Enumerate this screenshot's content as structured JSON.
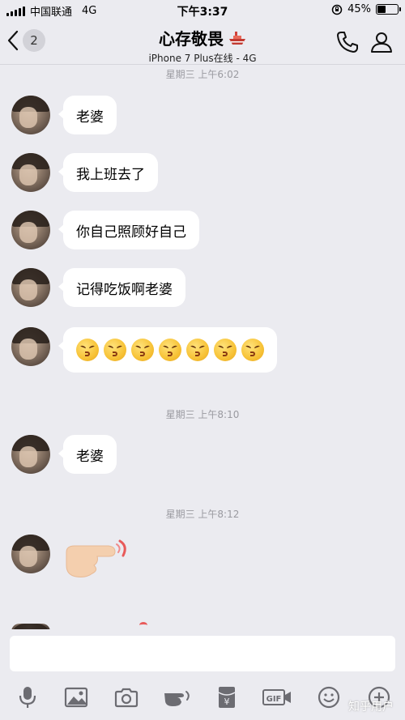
{
  "status_bar": {
    "carrier": "中国联通",
    "network": "4G",
    "time": "下午3:37",
    "battery_percent_label": "45%",
    "battery_level": 0.45
  },
  "header": {
    "back_count": "2",
    "title": "心存敬畏",
    "title_emoji": "ship-icon",
    "subtitle": "iPhone 7 Plus在线 - 4G"
  },
  "timestamps": [
    "星期三 上午6:02",
    "星期三 上午8:10",
    "星期三 上午8:12"
  ],
  "messages": [
    {
      "text": "老婆"
    },
    {
      "text": "我上班去了"
    },
    {
      "text": "你自己照顾好自己"
    },
    {
      "text": "记得吃饭啊老婆"
    },
    {
      "emoji": "kissing-face-icon",
      "count": 7
    },
    {
      "text": "老婆"
    },
    {
      "emoji": "pointing-hand-icon"
    }
  ],
  "input": {
    "value": "",
    "placeholder": ""
  },
  "toolbar": [
    "microphone-icon",
    "image-icon",
    "camera-icon",
    "poke-hand-icon",
    "red-packet-icon",
    "gif-icon",
    "smiley-icon",
    "plus-icon"
  ],
  "watermark": "知乎用户"
}
